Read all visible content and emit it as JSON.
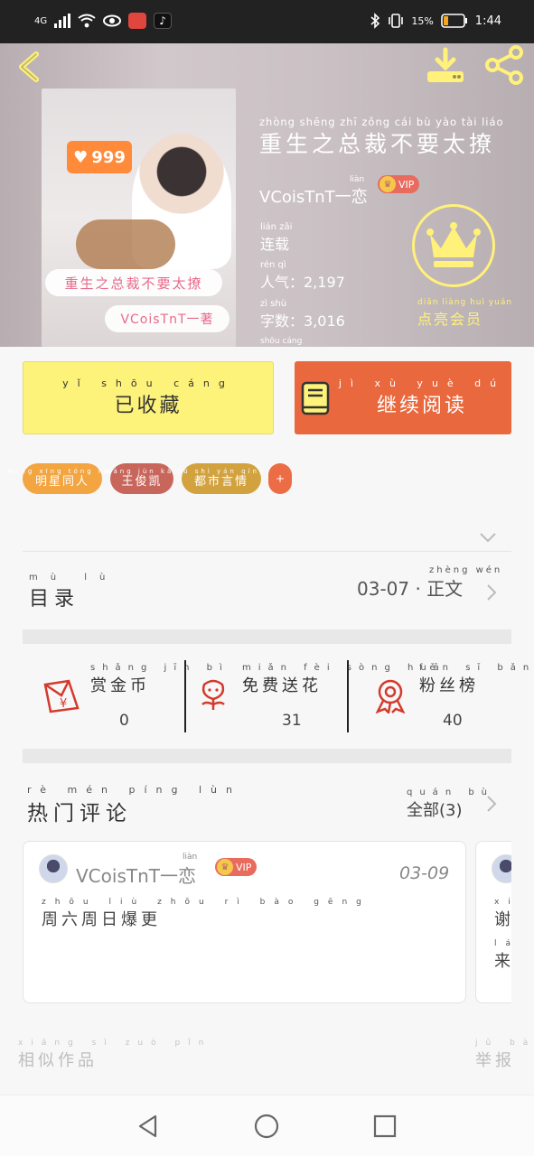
{
  "status_bar": {
    "network": "4G",
    "battery_percent": "15%",
    "time": "1:44"
  },
  "book": {
    "title_pinyin": "zhòng shēng zhī zǒng cái bù yào tài liáo",
    "title": "重生之总裁不要太撩",
    "author": "VCoisTnT一恋",
    "author_pinyin": "liàn",
    "vip_label": "VIP",
    "status_pinyin": "lián zǎi",
    "status": "连载",
    "popularity_pinyin": "rén qì",
    "popularity": "人气：2,197",
    "word_count_pinyin": "zì shù",
    "word_count": "字数：3,016",
    "extra_pinyin": "shōu cáng",
    "cover_badge": "999",
    "cover_title": "重生之总裁不要太撩",
    "cover_author": "VCoisTnT一著",
    "member_pinyin": "diǎn liàng huì yuán",
    "member_label": "点亮会员"
  },
  "actions": {
    "favorite_pinyin": "yǐ shōu cáng",
    "favorite_label": "已收藏",
    "read_pinyin": "jì xù yuè dú",
    "read_label": "继续阅读"
  },
  "tags": [
    {
      "pinyin": "míng xīng tóng rén",
      "label": "明星同人",
      "color": "#f2a540"
    },
    {
      "pinyin": "wáng jùn kǎi",
      "label": "王俊凯",
      "color": "#c9665c"
    },
    {
      "pinyin": "dū shì yán qíng",
      "label": "都市言情",
      "color": "#d2a23e"
    },
    {
      "pinyin": "",
      "label": "+",
      "color": "#ec6d45"
    }
  ],
  "toc": {
    "title_pinyin": "mù lù",
    "title": "目录",
    "latest_pinyin": "zhèng wén",
    "latest": "03-07 · 正文"
  },
  "stats": [
    {
      "pinyin": "shǎng jīn bì",
      "label": "赏金币",
      "value": "0",
      "icon": "red-envelope-icon"
    },
    {
      "pinyin": "miǎn fèi sòng huā",
      "label": "免费送花",
      "value": "31",
      "icon": "flower-icon"
    },
    {
      "pinyin": "fěn sī bǎng",
      "label": "粉丝榜",
      "value": "40",
      "icon": "medal-icon"
    }
  ],
  "comments_section": {
    "title_pinyin": "rè mén píng lùn",
    "title": "热门评论",
    "all_pinyin": "quán bù",
    "all_label": "全部(3)"
  },
  "comments": [
    {
      "author": "VCoisTnT一恋",
      "author_pinyin": "liàn",
      "vip": "VIP",
      "date": "03-09",
      "text_pinyin": "zhōu liù zhōu rì bào gēng",
      "text": "周六周日爆更"
    },
    {
      "text_pinyin_1": "xiè",
      "text_1": "谢",
      "text_pinyin_2": "lái",
      "text_2": "来"
    }
  ],
  "footer": {
    "similar_pinyin": "xiāng sì zuò pǐn",
    "similar_label": "相似作品",
    "report_pinyin": "jǔ bào",
    "report_label": "举报"
  },
  "colors": {
    "accent_orange": "#e9683e",
    "accent_yellow": "#fdf27a",
    "crown_yellow": "#fff17a"
  }
}
